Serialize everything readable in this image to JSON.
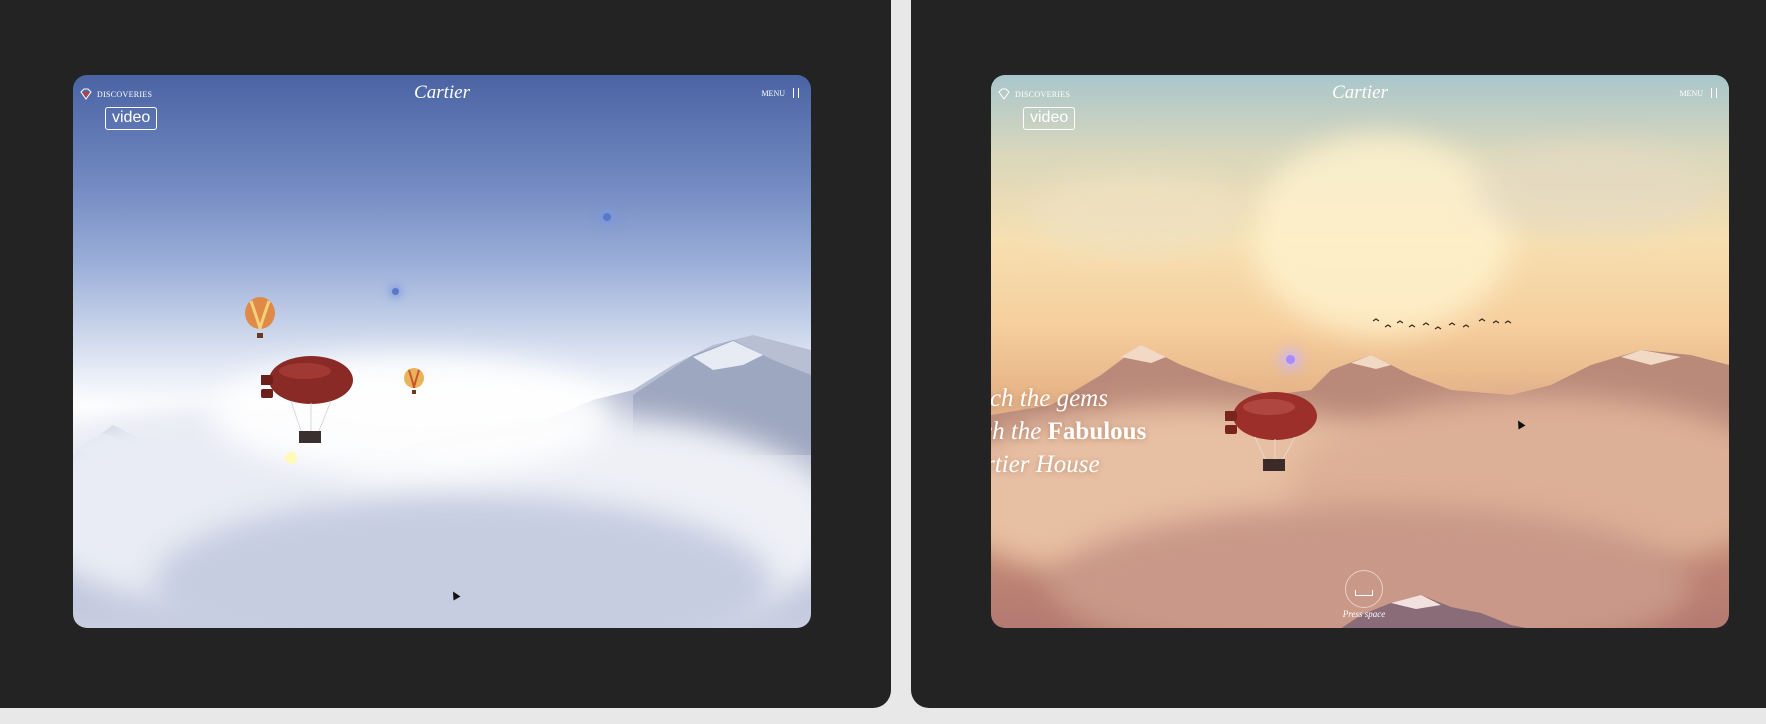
{
  "screens": [
    {
      "nav": {
        "discoveries_label": "DISCOVERIES",
        "logo_text": "Cartier",
        "menu_label": "MENU"
      },
      "video_badge": "video",
      "scene": "blue-sky"
    },
    {
      "nav": {
        "discoveries_label": "DISCOVERIES",
        "logo_text": "Cartier",
        "menu_label": "MENU"
      },
      "video_badge": "video",
      "scene": "sunset-sky",
      "headline": {
        "line1": "tch the gems",
        "line2_prefix": "ch the ",
        "line2_emphasis": "Fabulous",
        "line3": "rtier House"
      },
      "press_space_label": "Press space"
    }
  ],
  "colors": {
    "frame_bg": "#232323",
    "page_bg": "#e8e8e8",
    "balloon_red": "#8a2a26",
    "hotspot_blue": "#5a78c8",
    "hotspot_violet": "#a58cff"
  }
}
